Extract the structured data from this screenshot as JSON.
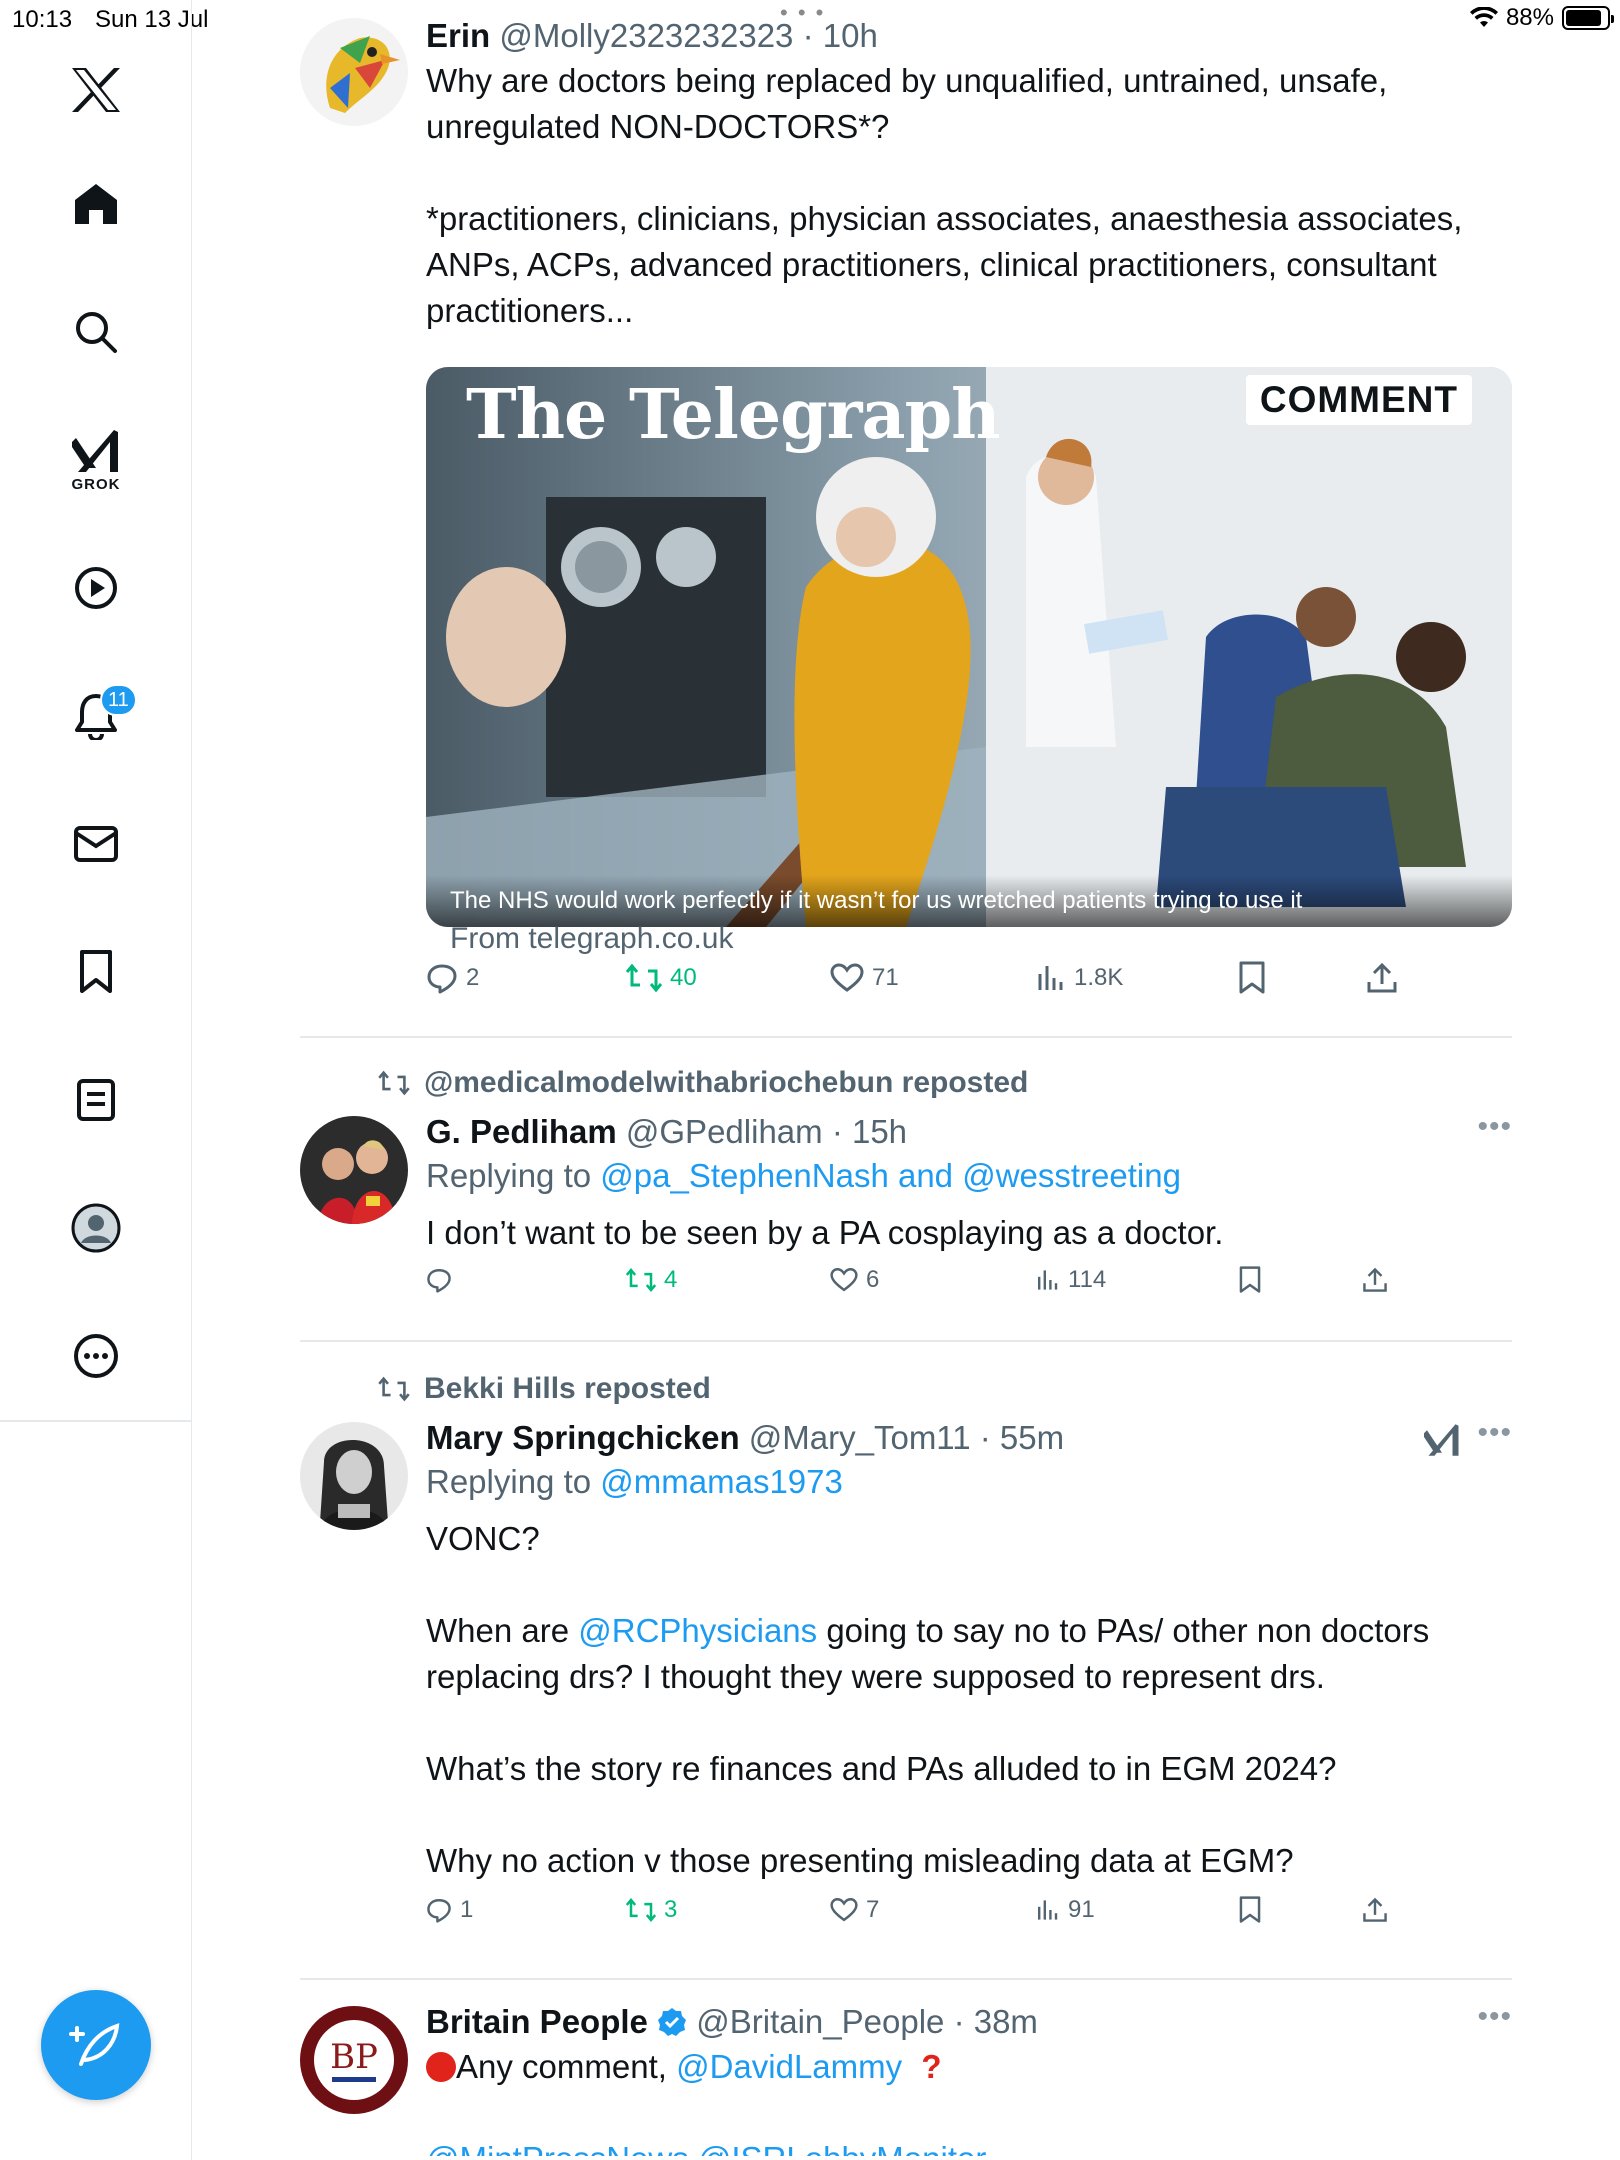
{
  "status_bar": {
    "time": "10:13",
    "date": "Sun 13 Jul",
    "battery": "88%",
    "battery_level": 0.88
  },
  "sidebar": {
    "grok_label": "GROK",
    "notifications_badge": "11",
    "items": [
      "x-logo",
      "home-icon",
      "search-icon",
      "grok-icon",
      "video-icon",
      "bell-icon",
      "mail-icon",
      "bookmark-icon",
      "list-icon",
      "profile-icon",
      "more-icon"
    ]
  },
  "tweets": [
    {
      "name": "Erin",
      "handle": "@Molly2323232323",
      "time": "· 10h",
      "text1": "Why are doctors being replaced by unqualified, untrained, unsafe, unregulated NON-DOCTORS*?",
      "text2": "*practitioners, clinicians, physician associates, anaesthesia associates, ANPs, ACPs, advanced practitioners, clinical practitioners, consultant practitioners...",
      "media": {
        "masthead": "The Telegraph",
        "tag": "COMMENT",
        "caption": "The NHS would work perfectly if it wasn’t for us wretched patients trying to use it",
        "source": "From telegraph.co.uk"
      },
      "replies": "2",
      "reposts": "40",
      "likes": "71",
      "views": "1.8K"
    },
    {
      "repost_by": "@medicalmodelwithabriochebun reposted",
      "name": "G. Pedliham",
      "handle": "@GPedliham",
      "time": "· 15h",
      "replying_prefix": "Replying to ",
      "replying_to": "@pa_StephenNash and @wesstreeting",
      "text": "I don’t want to be seen by a PA cosplaying as a doctor.",
      "replies": "",
      "reposts": "4",
      "likes": "6",
      "views": "114"
    },
    {
      "repost_by": "Bekki Hills reposted",
      "name": "Mary Springchicken",
      "handle": "@Mary_Tom11",
      "time": "· 55m",
      "replying_prefix": "Replying to ",
      "replying_to": "@mmamas1973",
      "text1": "VONC?",
      "text2_pre": "When are ",
      "text2_link": "@RCPhysicians",
      "text2_post": " going to say no to PAs/ other non doctors replacing drs?  I thought they were supposed to represent drs.",
      "text3": "What’s the story re finances and PAs alluded to in EGM 2024?",
      "text4": "Why no action v those presenting misleading data at EGM?",
      "replies": "1",
      "reposts": "3",
      "likes": "7",
      "views": "91"
    },
    {
      "name": "Britain People",
      "handle": "@Britain_People",
      "time": "· 38m",
      "avatar_text": "BP",
      "text_pre": "Any comment, ",
      "text_link": "@DavidLammy",
      "text_cut": "@MintPressNews @ISRLobbyMonitor"
    }
  ],
  "colors": {
    "accent": "#1d9bf0",
    "repost_green": "#00ba7c",
    "muted": "#536471"
  }
}
